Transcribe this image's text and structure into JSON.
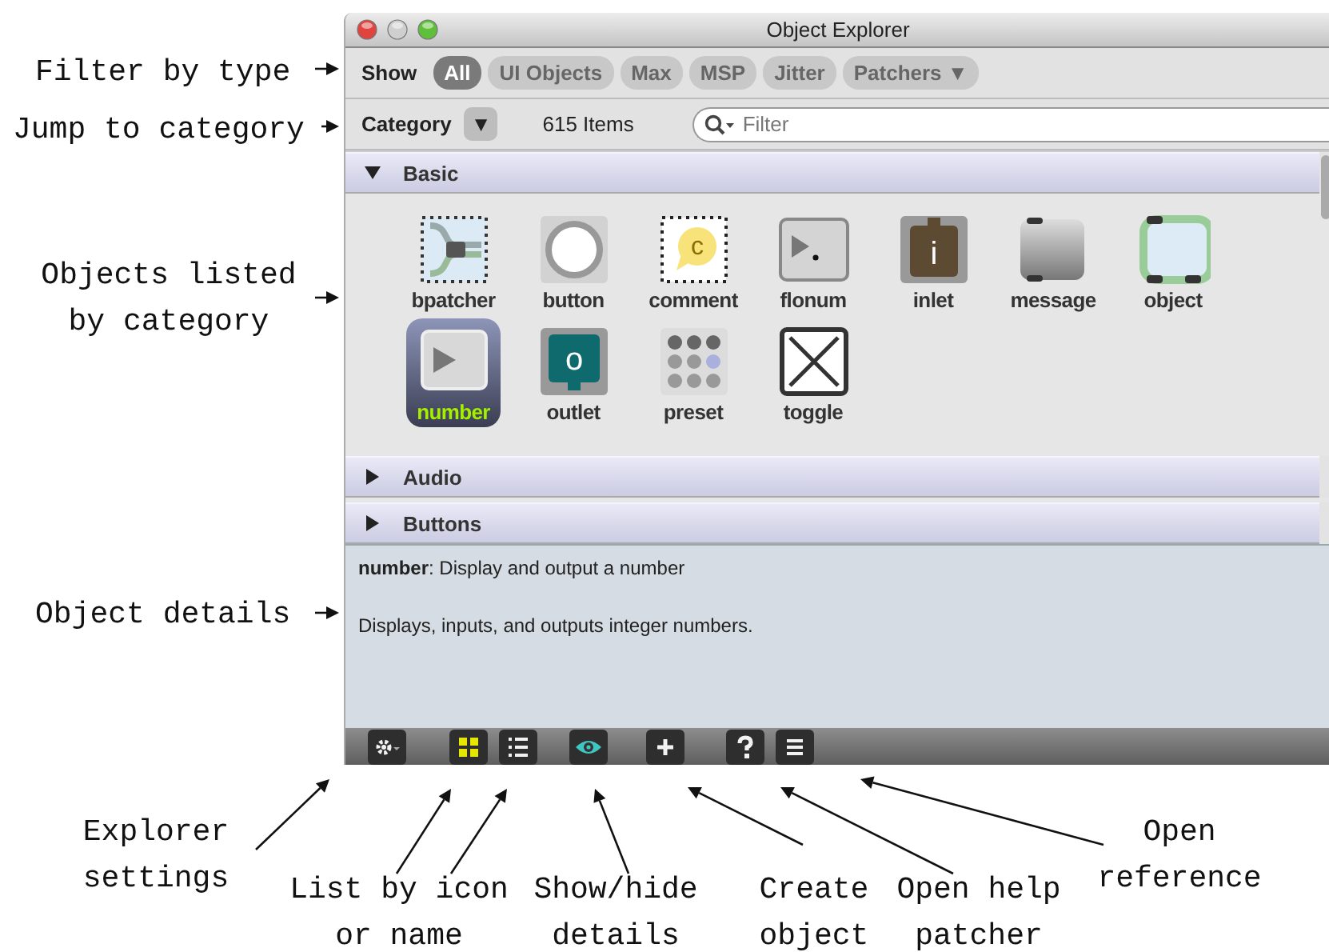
{
  "window": {
    "title": "Object Explorer"
  },
  "filter": {
    "label": "Show",
    "types": [
      {
        "label": "All",
        "selected": true
      },
      {
        "label": "UI Objects",
        "selected": false
      },
      {
        "label": "Max",
        "selected": false
      },
      {
        "label": "MSP",
        "selected": false
      },
      {
        "label": "Jitter",
        "selected": false
      },
      {
        "label": "Patchers ▼",
        "selected": false
      }
    ]
  },
  "category": {
    "label": "Category",
    "menu": "▼",
    "count": "615 Items",
    "search": {
      "placeholder": "Filter"
    }
  },
  "sections": [
    {
      "label": "Basic",
      "expanded": true,
      "items": [
        {
          "name": "bpatcher",
          "kind": "bpatcher",
          "selected": false
        },
        {
          "name": "button",
          "kind": "button",
          "selected": false
        },
        {
          "name": "comment",
          "kind": "comment",
          "glyph": "c",
          "selected": false
        },
        {
          "name": "flonum",
          "kind": "flonum",
          "selected": false
        },
        {
          "name": "inlet",
          "kind": "inlet",
          "glyph": "i",
          "selected": false
        },
        {
          "name": "message",
          "kind": "message",
          "selected": false
        },
        {
          "name": "object",
          "kind": "object",
          "selected": false
        },
        {
          "name": "number",
          "kind": "number",
          "selected": true
        },
        {
          "name": "outlet",
          "kind": "outlet",
          "glyph": "o",
          "selected": false
        },
        {
          "name": "preset",
          "kind": "preset",
          "selected": false
        },
        {
          "name": "toggle",
          "kind": "toggle",
          "selected": false
        }
      ]
    },
    {
      "label": "Audio",
      "expanded": false
    },
    {
      "label": "Buttons",
      "expanded": false
    }
  ],
  "details": {
    "summary": "**number**: Display and output a number",
    "description": "Displays, inputs, and outputs integer numbers."
  },
  "toolbar": [
    {
      "kind": "settings",
      "on": false
    },
    {
      "kind": "grid",
      "on": true
    },
    {
      "kind": "list",
      "on": false
    },
    {
      "kind": "eye",
      "on": true
    },
    {
      "kind": "plus",
      "on": false
    },
    {
      "kind": "help",
      "on": false
    },
    {
      "kind": "reference",
      "on": false
    }
  ],
  "callouts": [
    {
      "lines": [
        "Filter by type"
      ]
    },
    {
      "lines": [
        "Jump to category"
      ]
    },
    {
      "lines": [
        "Objects listed",
        "by category"
      ]
    },
    {
      "lines": [
        "Object details"
      ]
    },
    {
      "lines": [
        "Explorer",
        "settings"
      ]
    },
    {
      "lines": [
        "List by icon",
        "or name"
      ]
    },
    {
      "lines": [
        "Show/hide",
        "details"
      ]
    },
    {
      "lines": [
        "Create",
        "object"
      ]
    },
    {
      "lines": [
        "Open help",
        "patcher"
      ]
    },
    {
      "lines": [
        "Open",
        "reference"
      ]
    }
  ]
}
